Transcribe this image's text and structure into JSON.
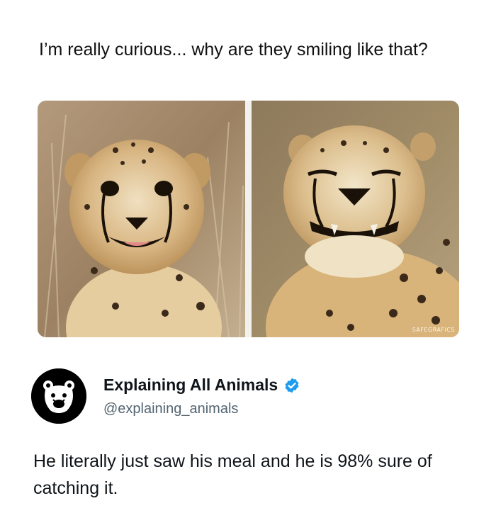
{
  "post": {
    "text": "I’m really curious... why are they smiling like that?"
  },
  "media": {
    "left_image": {
      "icon": "cheetah-smiling-photo"
    },
    "right_image": {
      "icon": "cheetah-grinning-photo"
    },
    "watermark": "SAFEGRAFICS"
  },
  "reply_author": {
    "display_name": "Explaining All Animals",
    "handle": "@explaining_animals",
    "avatar_icon": "bear-head-icon",
    "verified_icon": "verified-badge-icon",
    "verified_color": "#1d9bf0"
  },
  "reply": {
    "text": "He literally just saw his meal and he is 98% sure of catching it."
  }
}
